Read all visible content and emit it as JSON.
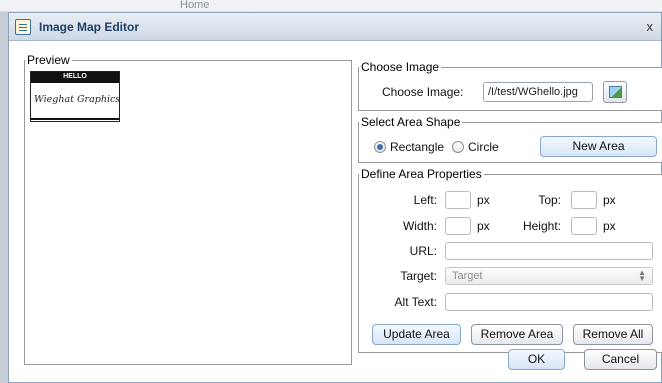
{
  "background": {
    "home_text": "Home"
  },
  "dialog": {
    "title": "Image Map Editor",
    "close_symbol": "x"
  },
  "preview": {
    "legend": "Preview",
    "image": {
      "badge_text": "HELLO",
      "name_text": "Wieghat Graphics"
    }
  },
  "choose_image": {
    "legend": "Choose Image",
    "label": "Choose Image:",
    "value": "/I/test/WGhello.jpg"
  },
  "select_shape": {
    "legend": "Select Area Shape",
    "options": [
      {
        "label": "Rectangle",
        "selected": true
      },
      {
        "label": "Circle",
        "selected": false
      }
    ],
    "new_area_label": "New Area"
  },
  "define_props": {
    "legend": "Define Area Properties",
    "left_label": "Left:",
    "top_label": "Top:",
    "width_label": "Width:",
    "height_label": "Height:",
    "unit": "px",
    "url_label": "URL:",
    "target_label": "Target:",
    "target_placeholder": "Target",
    "alt_label": "Alt Text:",
    "buttons": {
      "update": "Update Area",
      "remove": "Remove Area",
      "remove_all": "Remove All"
    }
  },
  "footer": {
    "ok": "OK",
    "cancel": "Cancel"
  },
  "colors": {
    "title_text": "#1f3e6a",
    "title_bar": "#cfd9e5",
    "radio_selected": "#3d6fb8"
  }
}
